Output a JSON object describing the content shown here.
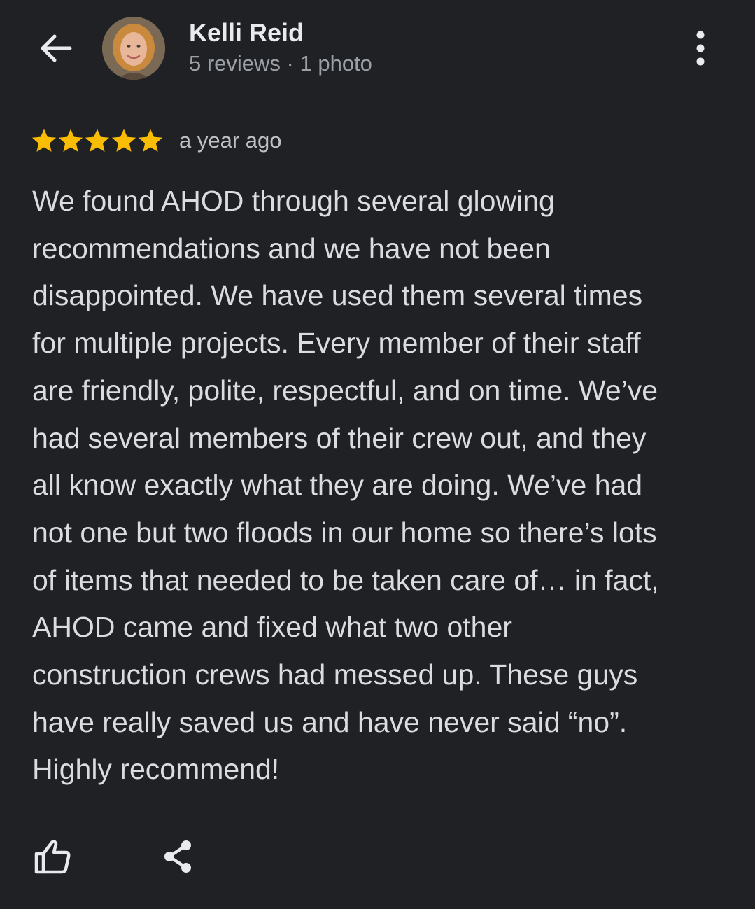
{
  "header": {
    "back_icon": "arrow-back-icon",
    "more_icon": "more-vertical-icon"
  },
  "reviewer": {
    "name": "Kelli Reid",
    "meta": "5 reviews · 1 photo",
    "avatar_icon": "reviewer-photo"
  },
  "review": {
    "rating": 5,
    "max_rating": 5,
    "star_color": "#fbbc04",
    "time": "a year ago",
    "text": "We found AHOD through several glowing\nrecommendations and we have not been\ndisappointed. We have used them several times\nfor multiple projects. Every member of their staff\nare friendly, polite, respectful, and on time. We’ve\nhad several members of their crew out, and they\nall know exactly what they are doing. We’ve had\nnot one but two floods in our home so there’s lots\nof items that needed to be taken care of… in fact,\nAHOD came and fixed what two other\nconstruction crews had messed up. These guys\nhave really saved us and have never said “no”.\nHighly recommend!"
  },
  "actions": {
    "like_icon": "thumbs-up-icon",
    "share_icon": "share-icon"
  },
  "colors": {
    "background": "#202124",
    "primary_text": "#e8eaed",
    "secondary_text": "#9aa0a6",
    "icon": "#e8eaed"
  }
}
